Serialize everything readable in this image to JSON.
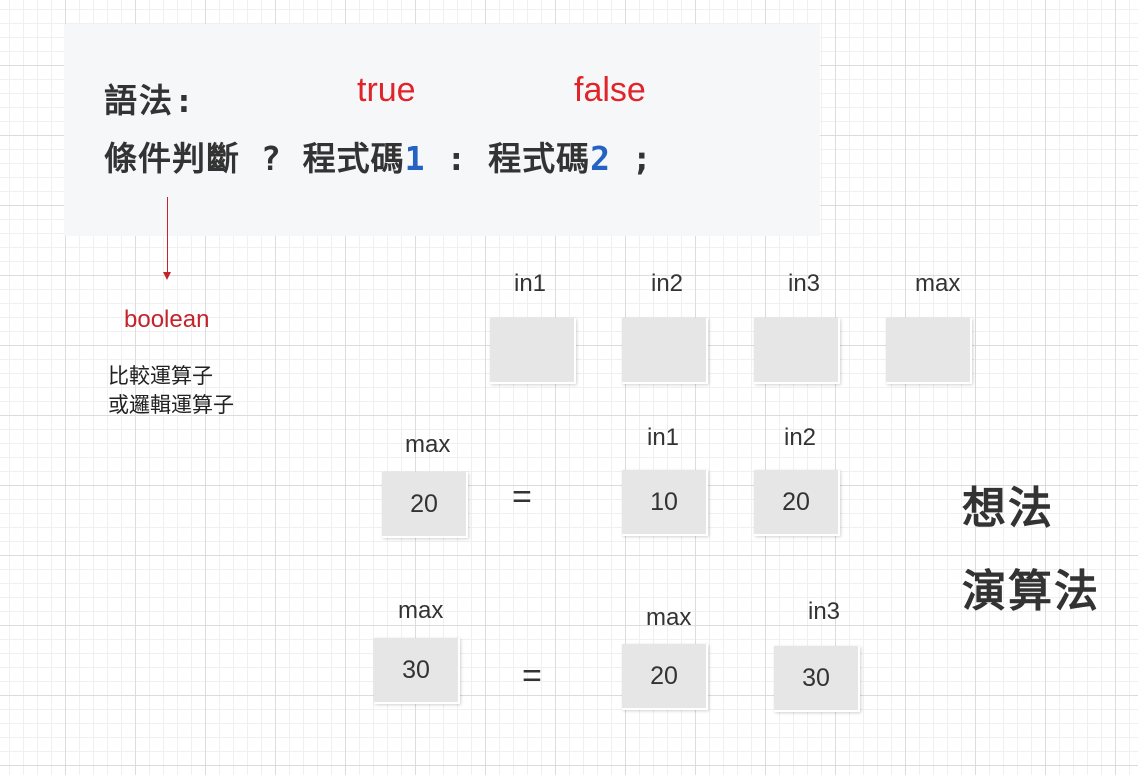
{
  "syntax": {
    "label": "語法:",
    "condition": "條件判斷",
    "question": "?",
    "code1": "程式碼",
    "num1": "1",
    "colon": ":",
    "code2": "程式碼",
    "num2": "2",
    "semicolon": ";",
    "true_label": "true",
    "false_label": "false"
  },
  "condition_note": {
    "type_label": "boolean",
    "line1": "比較運算子",
    "line2": "或邏輯運算子"
  },
  "variables_row": {
    "labels": [
      "in1",
      "in2",
      "in3",
      "max"
    ]
  },
  "step1": {
    "target_label": "max",
    "target_value": "20",
    "equals": "=",
    "left_label": "in1",
    "left_value": "10",
    "right_label": "in2",
    "right_value": "20"
  },
  "step2": {
    "target_label": "max",
    "target_value": "30",
    "equals": "=",
    "left_label": "max",
    "left_value": "20",
    "right_label": "in3",
    "right_value": "30"
  },
  "side_notes": {
    "line1": "想法",
    "line2": "演算法"
  },
  "colors": {
    "accent_red": "#e0242a",
    "arrow_red": "#c4232c",
    "number_blue": "#2463c4",
    "box_gray": "#e6e6e6"
  }
}
